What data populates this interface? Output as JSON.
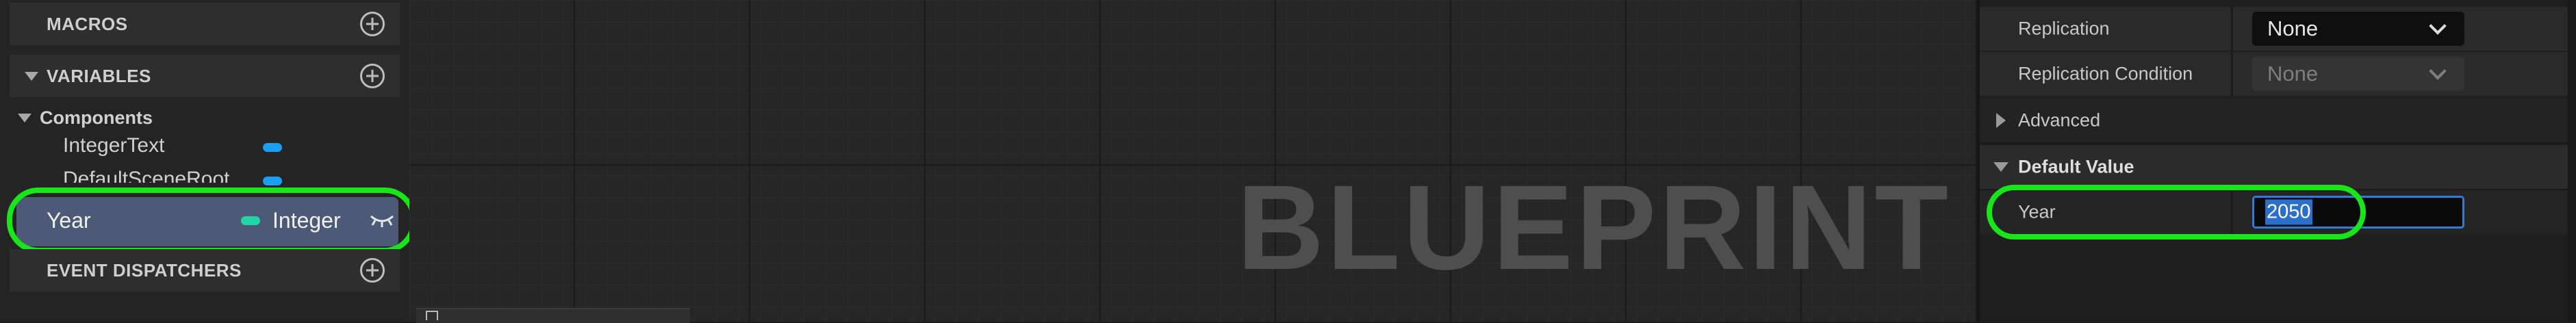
{
  "my_blueprint": {
    "macros_label": "MACROS",
    "variables_label": "VARIABLES",
    "components_label": "Components",
    "components": [
      {
        "name": "IntegerText",
        "pill_color": "#1a9ff2"
      },
      {
        "name": "DefaultSceneRoot",
        "pill_color": "#1a9ff2"
      }
    ],
    "selected_variable": {
      "name": "Year",
      "type": "Integer",
      "type_color": "#1fd6a4",
      "visibility_icon": "eye-closed-icon"
    },
    "event_dispatchers_label": "EVENT DISPATCHERS",
    "add_icon": "plus-circle-icon"
  },
  "graph": {
    "watermark": "BLUEPRINT"
  },
  "details": {
    "replication_label": "Replication",
    "replication_value": "None",
    "replication_condition_label": "Replication Condition",
    "replication_condition_value": "None",
    "advanced_label": "Advanced",
    "default_value_label": "Default Value",
    "year_label": "Year",
    "year_value": "2050"
  },
  "colors": {
    "highlight": "#19e619",
    "selection": "#4c5a78",
    "input_focus": "#2f7cd6"
  }
}
